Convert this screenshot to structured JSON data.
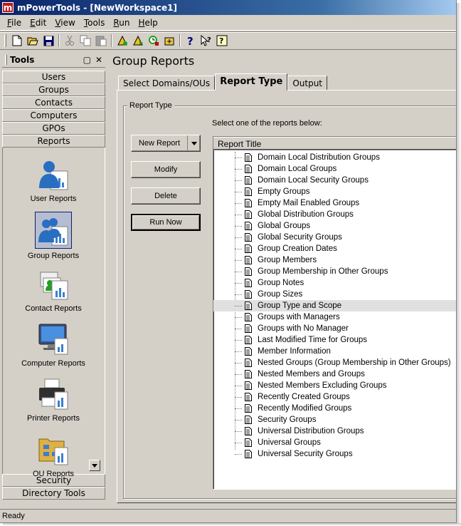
{
  "window": {
    "title": "mPowerTools - [NewWorkspace1]",
    "app_icon_letter": "m"
  },
  "menu": [
    {
      "label": "File",
      "key": "F",
      "rest": "ile"
    },
    {
      "label": "Edit",
      "key": "E",
      "rest": "dit"
    },
    {
      "label": "View",
      "key": "V",
      "rest": "iew"
    },
    {
      "label": "Tools",
      "key": "T",
      "rest": "ools"
    },
    {
      "label": "Run",
      "key": "R",
      "rest": "un"
    },
    {
      "label": "Help",
      "key": "H",
      "rest": "elp"
    }
  ],
  "toolbar": {
    "icons": [
      "new-icon",
      "open-icon",
      "save-icon",
      "cut-icon",
      "copy-icon",
      "paste-icon",
      "run-icon",
      "run-selected-icon",
      "schedule-icon",
      "export-icon",
      "help-icon",
      "context-help-icon",
      "about-icon"
    ]
  },
  "tools_panel": {
    "title": "Tools",
    "nav_top": [
      "Users",
      "Groups",
      "Contacts",
      "Computers",
      "GPOs",
      "Reports"
    ],
    "report_items": [
      {
        "label": "User Reports",
        "icon": "user-reports-icon"
      },
      {
        "label": "Group Reports",
        "icon": "group-reports-icon",
        "selected": true
      },
      {
        "label": "Contact Reports",
        "icon": "contact-reports-icon"
      },
      {
        "label": "Computer Reports",
        "icon": "computer-reports-icon"
      },
      {
        "label": "Printer Reports",
        "icon": "printer-reports-icon"
      },
      {
        "label": "OU Reports",
        "icon": "ou-reports-icon"
      }
    ],
    "nav_bottom": [
      "Security",
      "Directory Tools"
    ]
  },
  "content": {
    "title": "Group Reports",
    "tabs": [
      "Select Domains/OUs",
      "Report Type",
      "Output"
    ],
    "active_tab": "Report Type",
    "groupbox_label": "Report Type",
    "buttons": {
      "new_report": "New Report",
      "modify": "Modify",
      "delete": "Delete",
      "run_now": "Run Now"
    },
    "instruction": "Select one of the reports below:",
    "list_header": "Report Title",
    "reports": [
      "Domain Local Distribution Groups",
      "Domain Local Groups",
      "Domain Local Security Groups",
      "Empty Groups",
      "Empty Mail Enabled Groups",
      "Global Distribution Groups",
      "Global Groups",
      "Global Security Groups",
      "Group Creation Dates",
      "Group Members",
      "Group Membership in Other Groups",
      "Group Notes",
      "Group Sizes",
      "Group Type and Scope",
      "Groups with Managers",
      "Groups with No Manager",
      "Last Modified Time for Groups",
      "Member Information",
      "Nested Groups (Group Membership in Other Groups)",
      "Nested Members and Groups",
      "Nested Members Excluding Groups",
      "Recently Created Groups",
      "Recently Modified Groups",
      "Security Groups",
      "Universal Distribution Groups",
      "Universal Groups",
      "Universal Security Groups"
    ],
    "selected_report": "Group Type and Scope"
  },
  "status": {
    "text": "Ready"
  }
}
